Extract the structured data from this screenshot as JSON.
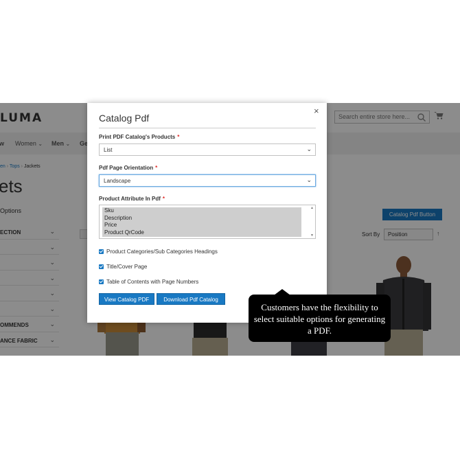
{
  "store": {
    "logo": "LUMA",
    "search_placeholder": "Search entire store here...",
    "nav": [
      {
        "label": "w"
      },
      {
        "label": "Women"
      },
      {
        "label": "Men"
      },
      {
        "label": "Ge"
      }
    ],
    "breadcrumb": {
      "a": "en",
      "b": "Tops",
      "current": "Jackets"
    },
    "page_title": "ets",
    "shop_options": "Options",
    "filters": [
      "ECTION",
      "",
      "",
      "",
      "",
      "",
      "OMMENDS",
      "ANCE FABRIC"
    ],
    "catalog_pdf_button": "Catalog Pdf Button",
    "sort_by_label": "Sort By",
    "sort_by_value": "Position"
  },
  "modal": {
    "title": "Catalog Pdf",
    "close": "×",
    "field_products_label": "Print PDF Catalog's Products",
    "field_products_value": "List",
    "field_orientation_label": "Pdf Page Orientation",
    "field_orientation_value": "Landscape",
    "field_attribute_label": "Product Attribute In Pdf",
    "attributes": [
      "Sku",
      "Description",
      "Price",
      "Product QrCode"
    ],
    "required_mark": "*",
    "checkboxes": [
      {
        "label": "Product Categories/Sub Categories Headings",
        "checked": true
      },
      {
        "label": "Title/Cover Page",
        "checked": true
      },
      {
        "label": "Table of Contents with Page Numbers",
        "checked": true
      }
    ],
    "view_button": "View Catalog PDF",
    "download_button": "Download Pdf Catalog"
  },
  "tooltip": {
    "text": "Customers have the flexibility to select suitable options for generating a PDF."
  },
  "colors": {
    "accent": "#1979c3",
    "required": "#e02b27",
    "tooltip_bg": "#000000"
  }
}
